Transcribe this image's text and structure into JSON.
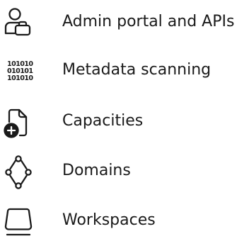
{
  "menu": {
    "items": [
      {
        "label": "Admin portal and APIs",
        "icon": "admin-user-icon"
      },
      {
        "label": "Metadata scanning",
        "icon": "binary-data-icon"
      },
      {
        "label": "Capacities",
        "icon": "document-add-icon"
      },
      {
        "label": "Domains",
        "icon": "domain-nodes-icon"
      },
      {
        "label": "Workspaces",
        "icon": "workspace-icon"
      }
    ],
    "binary_rows": [
      "101010",
      "010101",
      "101010"
    ]
  }
}
